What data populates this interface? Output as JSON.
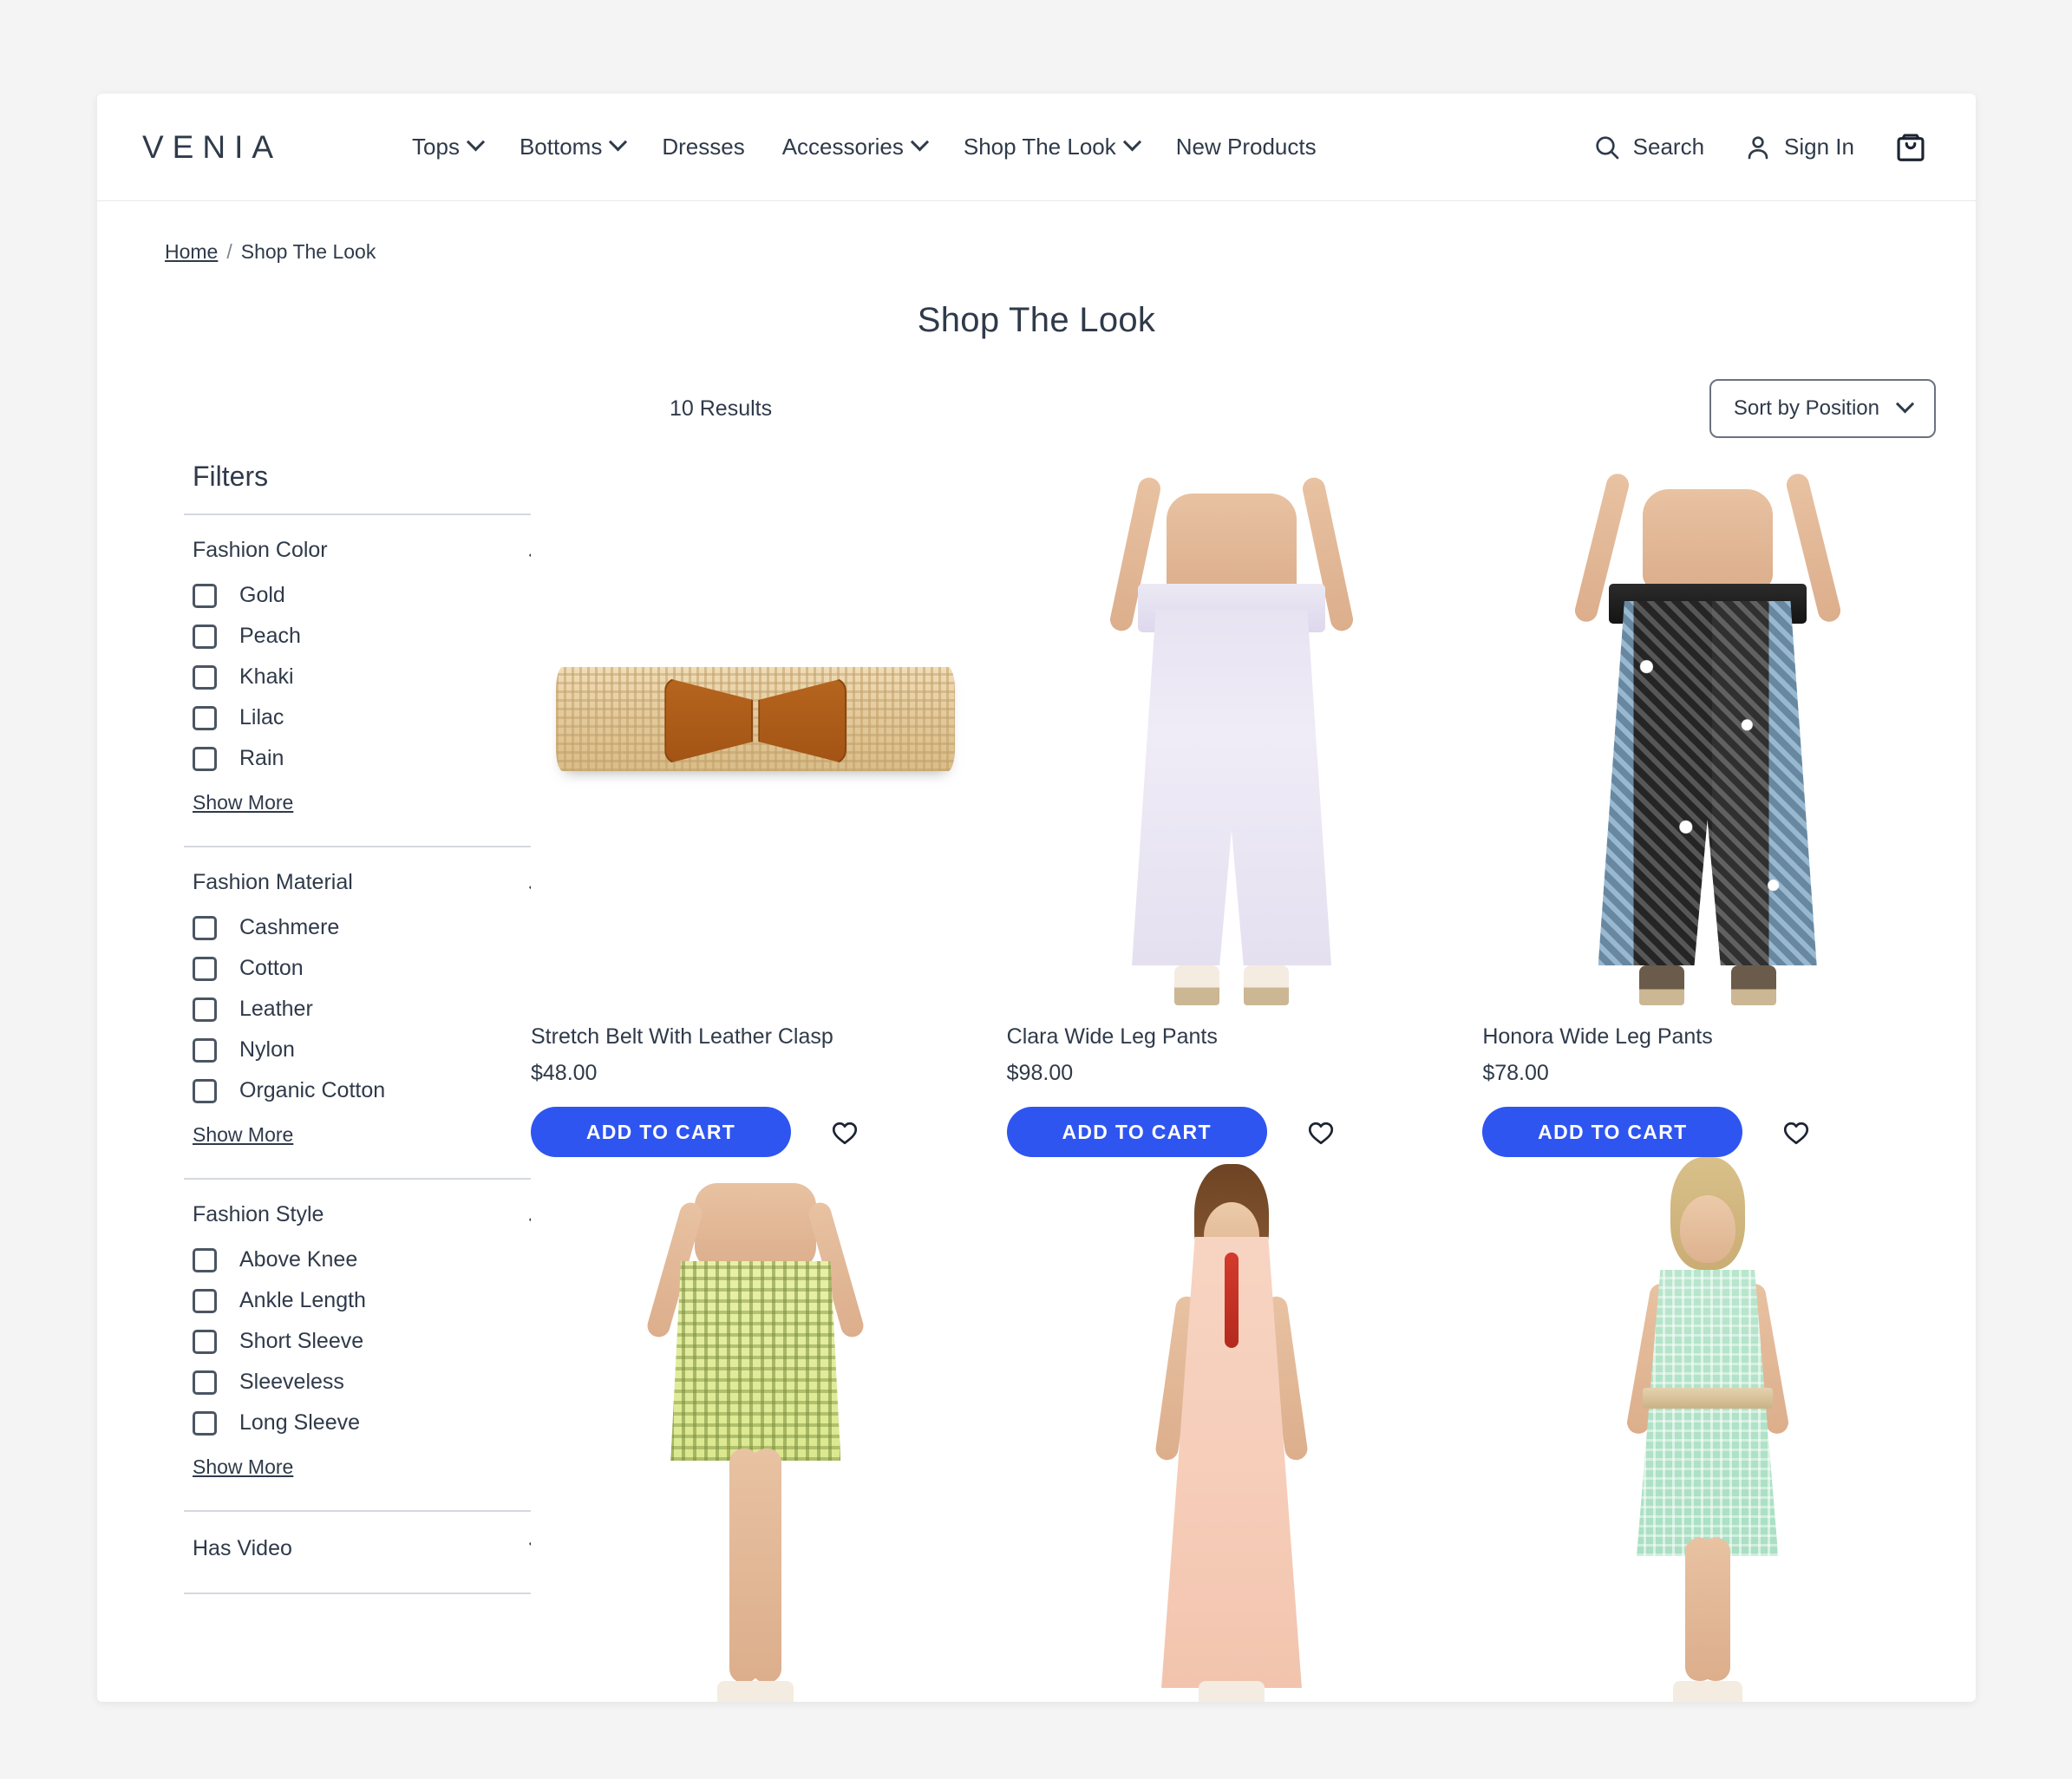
{
  "brand": {
    "logo": "VENIA"
  },
  "nav": {
    "items": [
      {
        "label": "Tops",
        "has_dropdown": true
      },
      {
        "label": "Bottoms",
        "has_dropdown": true
      },
      {
        "label": "Dresses",
        "has_dropdown": false
      },
      {
        "label": "Accessories",
        "has_dropdown": true
      },
      {
        "label": "Shop The Look",
        "has_dropdown": true
      },
      {
        "label": "New Products",
        "has_dropdown": false
      }
    ]
  },
  "header_actions": {
    "search_label": "Search",
    "signin_label": "Sign In",
    "cart_icon": "shopping-bag-icon"
  },
  "breadcrumb": {
    "home": "Home",
    "separator": "/",
    "current": "Shop The Look"
  },
  "page": {
    "title": "Shop The Look"
  },
  "toolbar": {
    "results_count": "10 Results",
    "sort_label": "Sort by Position"
  },
  "filters": {
    "title": "Filters",
    "show_more_label": "Show More",
    "groups": [
      {
        "label": "Fashion Color",
        "expanded": true,
        "options": [
          "Gold",
          "Peach",
          "Khaki",
          "Lilac",
          "Rain"
        ]
      },
      {
        "label": "Fashion Material",
        "expanded": true,
        "options": [
          "Cashmere",
          "Cotton",
          "Leather",
          "Nylon",
          "Organic Cotton"
        ]
      },
      {
        "label": "Fashion Style",
        "expanded": true,
        "options": [
          "Above Knee",
          "Ankle Length",
          "Short Sleeve",
          "Sleeveless",
          "Long Sleeve"
        ]
      },
      {
        "label": "Has Video",
        "expanded": false,
        "options": []
      }
    ]
  },
  "products": {
    "add_to_cart_label": "ADD TO CART",
    "items": [
      {
        "name": "Stretch Belt With Leather Clasp",
        "price": "$48.00",
        "image": "woven-straw-belt-with-brown-leather-bow-clasp"
      },
      {
        "name": "Clara Wide Leg Pants",
        "price": "$98.00",
        "image": "model-wearing-pale-lilac-wide-leg-pants"
      },
      {
        "name": "Honora Wide Leg Pants",
        "price": "$78.00",
        "image": "model-wearing-black-and-blue-paisley-print-wide-leg-pants"
      },
      {
        "name": "",
        "price": "",
        "image": "model-wearing-green-print-mini-skirt"
      },
      {
        "name": "",
        "price": "",
        "image": "model-wearing-peach-maxi-dress-with-red-necklace"
      },
      {
        "name": "",
        "price": "",
        "image": "model-wearing-mint-green-lace-dress-with-belt"
      }
    ]
  },
  "colors": {
    "accent_blue": "#2f55f0",
    "text_navy": "#2f3a4a",
    "page_bg": "#f4f4f4",
    "rule": "#d5d9e0"
  }
}
